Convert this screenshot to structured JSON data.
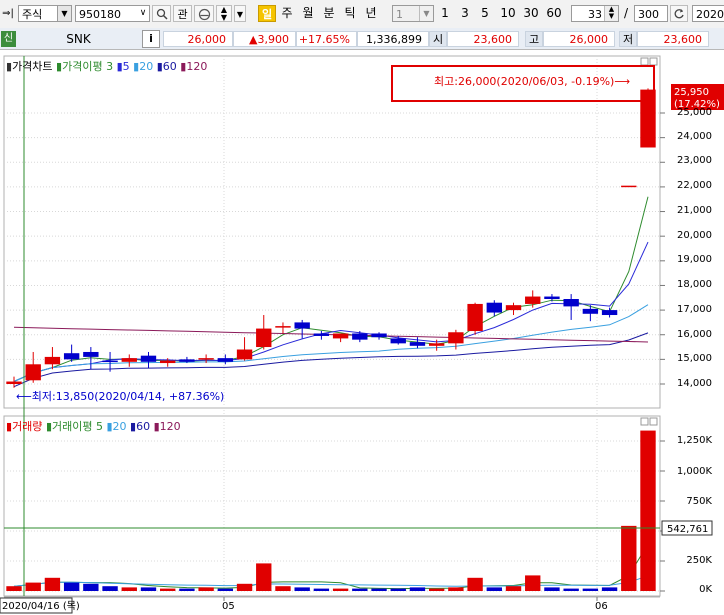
{
  "toolbar": {
    "arrows": "⇒|",
    "market": "주식",
    "code": "950180",
    "search_icon": "magnifier-icon",
    "watch": "관",
    "period_active": "일",
    "periods": [
      "주",
      "월",
      "분",
      "틱",
      "년"
    ],
    "interval_select": "1",
    "interval_buttons": [
      "1",
      "3",
      "5",
      "10",
      "30",
      "60"
    ],
    "count_value": "33",
    "slash": "/",
    "total_value": "300",
    "date_value": "2020"
  },
  "quote": {
    "badge": "신",
    "name": "SNK",
    "info": "i",
    "price": "26,000",
    "change": "▲3,900",
    "change_pct": "+17.65%",
    "volume": "1,336,899",
    "open_label": "시",
    "open": "23,600",
    "high_label": "고",
    "high": "26,000",
    "low_label": "저",
    "low": "23,600"
  },
  "price_panel": {
    "legend_title": "가격차트",
    "legend_ma_title": "가격이평",
    "legend_periods": [
      "3",
      "5",
      "20",
      "60",
      "120"
    ],
    "high_annotation": "최고:26,000(2020/06/03, -0.19%)⟶",
    "low_annotation": "⟵최저:13,850(2020/04/14, +87.36%)",
    "current_price_tag": "25,950",
    "current_pct_tag": "(17.42%)",
    "y_labels": [
      "25,000",
      "24,000",
      "23,000",
      "22,000",
      "21,000",
      "20,000",
      "19,000",
      "18,000",
      "17,000",
      "16,000",
      "15,000",
      "14,000"
    ]
  },
  "volume_panel": {
    "legend_title": "거래량",
    "legend_ma_title": "거래이평",
    "legend_periods": [
      "5",
      "20",
      "60",
      "120"
    ],
    "y_labels": [
      "1,250K",
      "1,000K",
      "750K",
      "500K",
      "250K",
      "0K"
    ],
    "current_tag": "542,761"
  },
  "x_axis": {
    "first_date": "2020/04/16 (목)",
    "labels": [
      "05",
      "06"
    ]
  },
  "colors": {
    "up": "#e00000",
    "down": "#0000cc",
    "ma3": "#2e8b2e",
    "ma5": "#2a2ad8",
    "ma20": "#3aa0e0",
    "ma60": "#1a1aa0",
    "ma120": "#8b1a5a"
  },
  "chart_data": [
    {
      "type": "candlestick",
      "title": "가격차트",
      "ylim": [
        13500,
        26200
      ],
      "candles": [
        {
          "o": 14000,
          "h": 14300,
          "l": 13850,
          "c": 14100
        },
        {
          "o": 14150,
          "h": 15300,
          "l": 14050,
          "c": 14800
        },
        {
          "o": 14800,
          "h": 15500,
          "l": 14600,
          "c": 15100
        },
        {
          "o": 15250,
          "h": 15600,
          "l": 14900,
          "c": 15000
        },
        {
          "o": 15300,
          "h": 15500,
          "l": 14600,
          "c": 15100
        },
        {
          "o": 14950,
          "h": 15300,
          "l": 14500,
          "c": 14900
        },
        {
          "o": 14900,
          "h": 15200,
          "l": 14700,
          "c": 15050
        },
        {
          "o": 15150,
          "h": 15300,
          "l": 14650,
          "c": 14900
        },
        {
          "o": 14850,
          "h": 15050,
          "l": 14700,
          "c": 14950
        },
        {
          "o": 15000,
          "h": 15100,
          "l": 14850,
          "c": 14900
        },
        {
          "o": 15000,
          "h": 15200,
          "l": 14850,
          "c": 15050
        },
        {
          "o": 15050,
          "h": 15200,
          "l": 14800,
          "c": 14900
        },
        {
          "o": 15000,
          "h": 15900,
          "l": 14950,
          "c": 15400
        },
        {
          "o": 15500,
          "h": 16800,
          "l": 15400,
          "c": 16250
        },
        {
          "o": 16300,
          "h": 16500,
          "l": 16050,
          "c": 16350
        },
        {
          "o": 16500,
          "h": 16600,
          "l": 15850,
          "c": 16250
        },
        {
          "o": 16050,
          "h": 16150,
          "l": 15800,
          "c": 15950
        },
        {
          "o": 15850,
          "h": 16050,
          "l": 15700,
          "c": 16050
        },
        {
          "o": 16050,
          "h": 16150,
          "l": 15700,
          "c": 15800
        },
        {
          "o": 16050,
          "h": 16100,
          "l": 15800,
          "c": 15900
        },
        {
          "o": 15850,
          "h": 15950,
          "l": 15600,
          "c": 15650
        },
        {
          "o": 15700,
          "h": 15900,
          "l": 15450,
          "c": 15550
        },
        {
          "o": 15550,
          "h": 15800,
          "l": 15350,
          "c": 15650
        },
        {
          "o": 15650,
          "h": 16200,
          "l": 15400,
          "c": 16100
        },
        {
          "o": 16150,
          "h": 17300,
          "l": 16000,
          "c": 17250
        },
        {
          "o": 17300,
          "h": 17400,
          "l": 16750,
          "c": 16900
        },
        {
          "o": 17000,
          "h": 17300,
          "l": 16800,
          "c": 17200
        },
        {
          "o": 17250,
          "h": 17800,
          "l": 17100,
          "c": 17550
        },
        {
          "o": 17550,
          "h": 17650,
          "l": 17350,
          "c": 17450
        },
        {
          "o": 17450,
          "h": 17650,
          "l": 16600,
          "c": 17150
        },
        {
          "o": 17050,
          "h": 17200,
          "l": 16550,
          "c": 16850
        },
        {
          "o": 17000,
          "h": 17100,
          "l": 16700,
          "c": 16800
        },
        {
          "o": 22050,
          "h": 22050,
          "l": 22050,
          "c": 22050
        },
        {
          "o": 23600,
          "h": 26000,
          "l": 23600,
          "c": 25950
        }
      ]
    },
    {
      "type": "bar",
      "title": "거래량",
      "ylim": [
        0,
        1300000
      ],
      "values": [
        40000,
        70000,
        110000,
        70000,
        60000,
        40000,
        30000,
        30000,
        20000,
        20000,
        30000,
        20000,
        60000,
        230000,
        40000,
        30000,
        20000,
        20000,
        20000,
        20000,
        20000,
        30000,
        20000,
        30000,
        110000,
        30000,
        40000,
        130000,
        30000,
        20000,
        20000,
        30000,
        542761,
        1336899
      ]
    }
  ]
}
